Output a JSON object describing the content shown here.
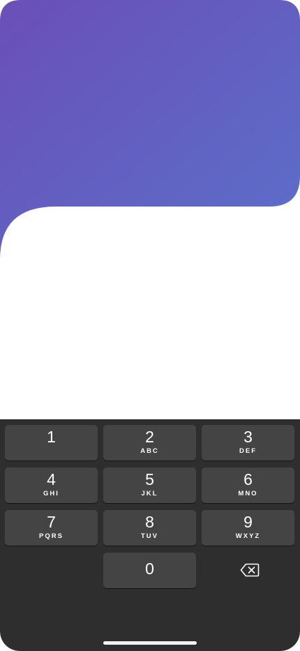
{
  "colors": {
    "gradient_start": "#6a4fb8",
    "gradient_end": "#5c6fc9",
    "keypad_background": "#2e2e2e",
    "key_background": "#444444",
    "key_text": "#ffffff"
  },
  "keypad": {
    "keys": [
      {
        "digit": "1",
        "letters": ""
      },
      {
        "digit": "2",
        "letters": "ABC"
      },
      {
        "digit": "3",
        "letters": "DEF"
      },
      {
        "digit": "4",
        "letters": "GHI"
      },
      {
        "digit": "5",
        "letters": "JKL"
      },
      {
        "digit": "6",
        "letters": "MNO"
      },
      {
        "digit": "7",
        "letters": "PQRS"
      },
      {
        "digit": "8",
        "letters": "TUV"
      },
      {
        "digit": "9",
        "letters": "WXYZ"
      },
      {
        "digit": "0",
        "letters": ""
      }
    ],
    "backspace_icon": "backspace-icon"
  }
}
